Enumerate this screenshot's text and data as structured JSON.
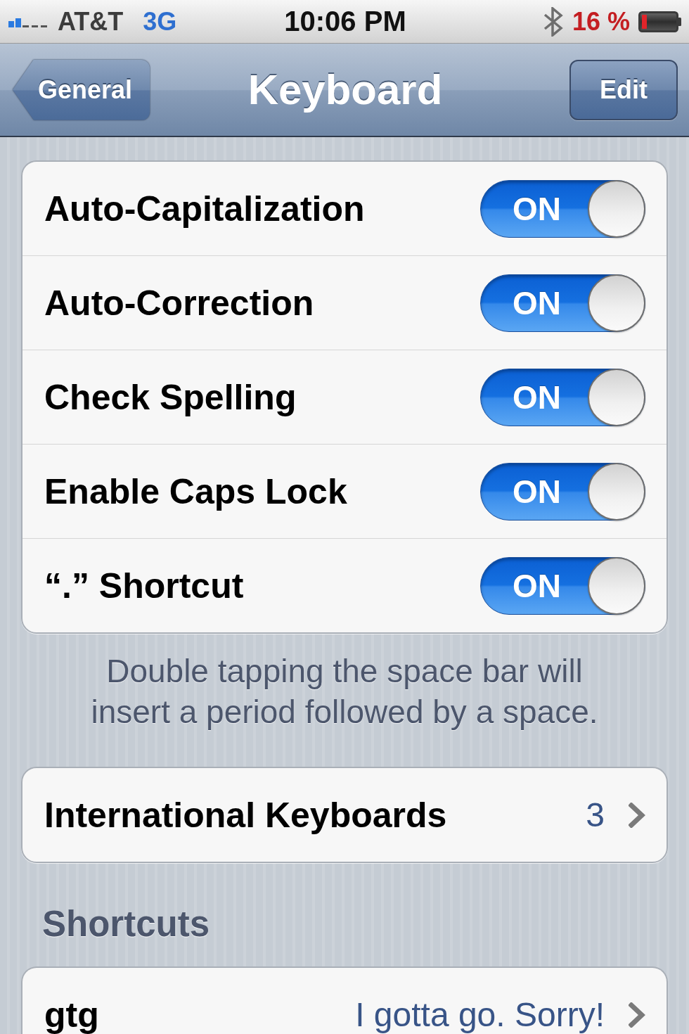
{
  "status_bar": {
    "carrier": "AT&T",
    "network": "3G",
    "time": "10:06 PM",
    "battery_percent": "16 %"
  },
  "nav_bar": {
    "back_button": "General",
    "title": "Keyboard",
    "right_button": "Edit"
  },
  "groups": [
    {
      "rows": [
        {
          "kind": "toggle",
          "label": "Auto-Capitalization",
          "switch_label": "ON",
          "on": true
        },
        {
          "kind": "toggle",
          "label": "Auto-Correction",
          "switch_label": "ON",
          "on": true
        },
        {
          "kind": "toggle",
          "label": "Check Spelling",
          "switch_label": "ON",
          "on": true
        },
        {
          "kind": "toggle",
          "label": "Enable Caps Lock",
          "switch_label": "ON",
          "on": true
        },
        {
          "kind": "toggle",
          "label": "“.” Shortcut",
          "switch_label": "ON",
          "on": true
        }
      ],
      "footer": "Double tapping the space bar will insert a period followed by a space."
    },
    {
      "rows": [
        {
          "kind": "disclosure",
          "label": "International Keyboards",
          "detail": "3"
        }
      ]
    },
    {
      "header": "Shortcuts",
      "rows": [
        {
          "kind": "disclosure",
          "label": "gtg",
          "detail": "I gotta go. Sorry!"
        }
      ]
    }
  ]
}
